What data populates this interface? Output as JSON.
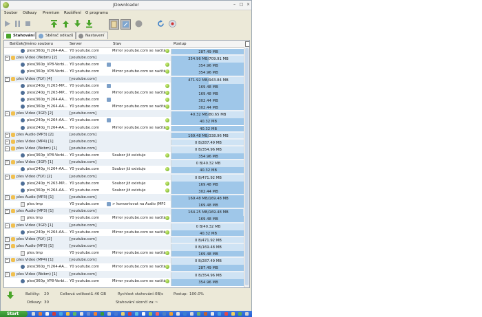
{
  "window": {
    "title": "JDownloader"
  },
  "menu": [
    "Soubor",
    "Odkazy",
    "Premium",
    "Rozšíření",
    "O programu"
  ],
  "tabs": [
    {
      "label": "Stahování",
      "icon": "download-tab-icon"
    },
    {
      "label": "Sběrač odkazů",
      "icon": "linkgrabber-tab-icon"
    },
    {
      "label": "Nastavení",
      "icon": "settings-tab-icon"
    }
  ],
  "table": {
    "headers": {
      "name": "Balíček/Jméno souboru",
      "server": "Server",
      "status": "Stav",
      "progress": "Postup"
    },
    "rows": [
      {
        "type": "file",
        "name": "ples(360p_H.264-AA...",
        "server": "Y0 youtube.com",
        "status": "Mirror youtube.com se načítá",
        "progress": "287.49 MB",
        "pct": 100,
        "ok": true,
        "host": false,
        "icon": "vid"
      },
      {
        "type": "pkg",
        "name": "ples Video (Webm) [2]",
        "server": "[youtube.com]",
        "status": "",
        "progress": "354.96 MB/709.91 MB",
        "pct": 50,
        "icon": "pk"
      },
      {
        "type": "file",
        "name": "ples(360p_VP8-Vorbi...",
        "server": "Y0 youtube.com",
        "status": "",
        "progress": "354.96 MB",
        "pct": 100,
        "ok": true,
        "host": true,
        "icon": "vid"
      },
      {
        "type": "file",
        "name": "ples(360p_VP8-Vorbi...",
        "server": "Y0 youtube.com",
        "status": "Mirror youtube.com se načítá",
        "progress": "354.96 MB",
        "pct": 100,
        "ok": true,
        "host": false,
        "icon": "vid"
      },
      {
        "type": "pkg",
        "name": "ples Video (FLV) [4]",
        "server": "[youtube.com]",
        "status": "",
        "progress": "471.92 MB/943.84 MB",
        "pct": 50,
        "icon": "pk"
      },
      {
        "type": "file",
        "name": "ples(240p_H.263-MP...",
        "server": "Y0 youtube.com",
        "status": "",
        "progress": "169.48 MB",
        "pct": 100,
        "ok": true,
        "host": true,
        "icon": "vid"
      },
      {
        "type": "file",
        "name": "ples(240p_H.263-MP...",
        "server": "Y0 youtube.com",
        "status": "Mirror youtube.com se načítá",
        "progress": "169.48 MB",
        "pct": 100,
        "ok": true,
        "host": false,
        "icon": "vid"
      },
      {
        "type": "file",
        "name": "ples(360p_H.264-AA...",
        "server": "Y0 youtube.com",
        "status": "",
        "progress": "302.44 MB",
        "pct": 100,
        "ok": true,
        "host": true,
        "icon": "vid"
      },
      {
        "type": "file",
        "name": "ples(360p_H.264-AA...",
        "server": "Y0 youtube.com",
        "status": "Mirror youtube.com se načítá",
        "progress": "302.44 MB",
        "pct": 100,
        "ok": true,
        "host": false,
        "icon": "vid"
      },
      {
        "type": "pkg",
        "name": "ples Video (3GP) [2]",
        "server": "[youtube.com]",
        "status": "",
        "progress": "40.32 MB/80.65 MB",
        "pct": 50,
        "icon": "pk"
      },
      {
        "type": "file",
        "name": "ples(240p_H.264-AA...",
        "server": "Y0 youtube.com",
        "status": "",
        "progress": "40.32 MB",
        "pct": 100,
        "ok": true,
        "host": true,
        "icon": "vid"
      },
      {
        "type": "file",
        "name": "ples(240p_H.264-AA...",
        "server": "Y0 youtube.com",
        "status": "Mirror youtube.com se načítá",
        "progress": "40.32 MB",
        "pct": 100,
        "ok": true,
        "host": false,
        "icon": "vid"
      },
      {
        "type": "pkg",
        "name": "ples Audio (MP3) [2]",
        "server": "[youtube.com]",
        "status": "",
        "progress": "169.48 MB/338.96 MB",
        "pct": 50,
        "icon": "pk"
      },
      {
        "type": "pkg",
        "name": "ples Video (MP4) [1]",
        "server": "[youtube.com]",
        "status": "",
        "progress": "0 B/287.49 MB",
        "pct": 0,
        "icon": "pk"
      },
      {
        "type": "pkg",
        "name": "ples Video (Webm) [1]",
        "server": "[youtube.com]",
        "status": "",
        "progress": "0 B/354.96 MB",
        "pct": 0,
        "icon": "pk"
      },
      {
        "type": "file",
        "name": "ples(360p_VP8-Vorbi...",
        "server": "Y0 youtube.com",
        "status": "Soubor již existuje",
        "progress": "354.96 MB",
        "pct": 100,
        "ok": true,
        "host": false,
        "icon": "vid"
      },
      {
        "type": "pkg",
        "name": "ples Video (3GP) [1]",
        "server": "[youtube.com]",
        "status": "",
        "progress": "0 B/40.32 MB",
        "pct": 0,
        "icon": "pk"
      },
      {
        "type": "file",
        "name": "ples(240p_H.264-AA...",
        "server": "Y0 youtube.com",
        "status": "Soubor již existuje",
        "progress": "40.32 MB",
        "pct": 100,
        "ok": true,
        "host": false,
        "icon": "vid"
      },
      {
        "type": "pkg",
        "name": "ples Video (FLV) [2]",
        "server": "[youtube.com]",
        "status": "",
        "progress": "0 B/471.92 MB",
        "pct": 0,
        "icon": "pk"
      },
      {
        "type": "file",
        "name": "ples(240p_H.263-MP...",
        "server": "Y0 youtube.com",
        "status": "Soubor již existuje",
        "progress": "169.48 MB",
        "pct": 100,
        "ok": true,
        "host": false,
        "icon": "vid"
      },
      {
        "type": "file",
        "name": "ples(360p_H.264-AA...",
        "server": "Y0 youtube.com",
        "status": "Soubor již existuje",
        "progress": "302.44 MB",
        "pct": 100,
        "ok": true,
        "host": false,
        "icon": "vid"
      },
      {
        "type": "pkg",
        "name": "ples Audio (MP3) [1]",
        "server": "[youtube.com]",
        "status": "",
        "progress": "169.48 MB/169.48 MB",
        "pct": 100,
        "icon": "pk"
      },
      {
        "type": "file",
        "name": "ples.tmp",
        "server": "Y0 youtube.com",
        "status": "> konvertovat na Audio (MP3)",
        "progress": "169.48 MB",
        "pct": 100,
        "ok": false,
        "host": true,
        "icon": "doc"
      },
      {
        "type": "pkg",
        "name": "ples Audio (MP3) [1]",
        "server": "[youtube.com]",
        "status": "",
        "progress": "164.25 MB/169.48 MB",
        "pct": 97,
        "icon": "pk"
      },
      {
        "type": "file",
        "name": "ples.tmp",
        "server": "Y0 youtube.com",
        "status": "Mirror youtube.com se načítá",
        "progress": "169.48 MB",
        "pct": 100,
        "ok": true,
        "host": false,
        "icon": "doc"
      },
      {
        "type": "pkg",
        "name": "ples Video (3GP) [1]",
        "server": "[youtube.com]",
        "status": "",
        "progress": "0 B/40.32 MB",
        "pct": 0,
        "icon": "pk"
      },
      {
        "type": "file",
        "name": "ples(240p_H.264-AA...",
        "server": "Y0 youtube.com",
        "status": "Mirror youtube.com se načítá",
        "progress": "40.32 MB",
        "pct": 100,
        "ok": true,
        "host": false,
        "icon": "vid"
      },
      {
        "type": "pkg",
        "name": "ples Video (FLV) [2]",
        "server": "[youtube.com]",
        "status": "",
        "progress": "0 B/471.92 MB",
        "pct": 0,
        "icon": "pk"
      },
      {
        "type": "pkg",
        "name": "ples Audio (MP3) [1]",
        "server": "[youtube.com]",
        "status": "",
        "progress": "0 B/169.48 MB",
        "pct": 0,
        "icon": "pk"
      },
      {
        "type": "file",
        "name": "ples.tmp",
        "server": "Y0 youtube.com",
        "status": "Mirror youtube.com se načítá",
        "progress": "169.48 MB",
        "pct": 100,
        "ok": true,
        "host": false,
        "icon": "doc"
      },
      {
        "type": "pkg",
        "name": "ples Video (MP4) [1]",
        "server": "[youtube.com]",
        "status": "",
        "progress": "0 B/287.49 MB",
        "pct": 0,
        "icon": "pk"
      },
      {
        "type": "file",
        "name": "ples(360p_H.264-AA...",
        "server": "Y0 youtube.com",
        "status": "Mirror youtube.com se načítá",
        "progress": "287.49 MB",
        "pct": 100,
        "ok": true,
        "host": false,
        "icon": "vid"
      },
      {
        "type": "pkg",
        "name": "ples Video (Webm) [1]",
        "server": "[youtube.com]",
        "status": "",
        "progress": "0 B/354.96 MB",
        "pct": 0,
        "icon": "pk"
      },
      {
        "type": "file",
        "name": "ples(360p_VP8-Vorbi...",
        "server": "Y0 youtube.com",
        "status": "Mirror youtube.com se načítá",
        "progress": "354.96 MB",
        "pct": 100,
        "ok": true,
        "host": false,
        "icon": "vid"
      }
    ]
  },
  "status": {
    "packages_label": "Balíčky:",
    "packages": "20",
    "links_label": "Odkazy:",
    "links": "30",
    "size_label": "Celková velikost:",
    "size": "1.46 GB",
    "speed_label": "Rychlost stahování:",
    "speed": "0B/s",
    "progress_label": "Postup:",
    "progress": "100.0%",
    "eta_label": "Stahování skončí za:",
    "eta": "~"
  },
  "taskbar": {
    "start": "Start"
  },
  "colors": {
    "accent": "#9fc7e9",
    "package_row": "#eaf0f6",
    "ok_green": "#5aa21a"
  }
}
